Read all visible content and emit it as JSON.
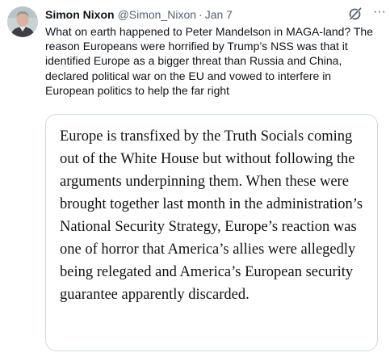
{
  "tweet": {
    "author_name": "Simon Nixon",
    "author_handle": "@Simon_Nixon",
    "separator": "·",
    "date": "Jan 7",
    "text": "What on earth happened to Peter Mandelson in MAGA-land? The reason Europeans were horrified by Trump’s NSS was that it identified Europe as a bigger threat than Russia and China, declared political war on the EU and vowed to interfere in European politics to help the far right",
    "more_label": "···",
    "grok_icon": "grok-icon",
    "more_icon": "more-icon"
  },
  "quote": {
    "text": "Europe is transfixed by the Truth Socials coming out of the White House but without following the arguments underpinning them. When these were brought together last month in the administration’s National Security Strategy, Europe’s reaction was one of horror that America’s allies were allegedly being relegated and America’s European security guarantee apparently discarded."
  },
  "colors": {
    "text": "#0f1419",
    "secondary": "#536471",
    "border": "#cfd9de"
  }
}
